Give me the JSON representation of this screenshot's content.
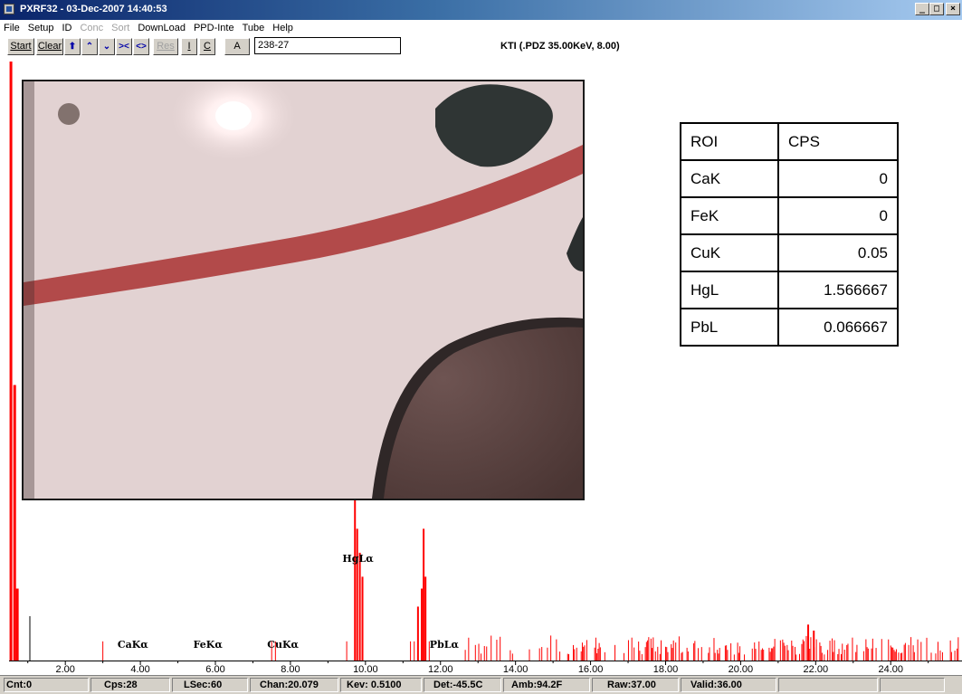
{
  "window": {
    "title": "PXRF32 - 03-Dec-2007 14:40:53",
    "minimize": "_",
    "maximize": "□",
    "close": "×"
  },
  "menu": [
    {
      "label": "File",
      "enabled": true
    },
    {
      "label": "Setup",
      "enabled": true
    },
    {
      "label": "ID",
      "enabled": true
    },
    {
      "label": "Conc",
      "enabled": false
    },
    {
      "label": "Sort",
      "enabled": false
    },
    {
      "label": "DownLoad",
      "enabled": true
    },
    {
      "label": "PPD-Inte",
      "enabled": true
    },
    {
      "label": "Tube",
      "enabled": true
    },
    {
      "label": "Help",
      "enabled": true
    }
  ],
  "toolbar": {
    "start": "Start",
    "clear": "Clear",
    "res": "Res",
    "i": "I",
    "c": "C",
    "a": "A",
    "sample_id": "238-27",
    "info": "KTI (.PDZ 35.00KeV, 8.00)"
  },
  "roi_table": {
    "headers": [
      "ROI",
      "CPS"
    ],
    "rows": [
      [
        "CaK",
        "0"
      ],
      [
        "FeK",
        "0"
      ],
      [
        "CuK",
        "0.05"
      ],
      [
        "HgL",
        "1.566667"
      ],
      [
        "PbL",
        "0.066667"
      ]
    ]
  },
  "chart_data": {
    "type": "bar",
    "xlabel": "",
    "ylabel": "",
    "xlim": [
      0.5,
      25.9
    ],
    "x_ticks": [
      "2.00",
      "4.00",
      "6.00",
      "8.00",
      "10.00",
      "12.00",
      "14.00",
      "16.00",
      "18.00",
      "20.00",
      "22.00",
      "24.00"
    ],
    "peak_labels": [
      {
        "label": "CaKα",
        "kev": 3.8
      },
      {
        "label": "FeKα",
        "kev": 5.8
      },
      {
        "label": "CuKα",
        "kev": 7.8
      },
      {
        "label": "HgLα",
        "kev": 9.8
      },
      {
        "label": "PbLα",
        "kev": 12.1
      }
    ],
    "major_peaks": [
      {
        "kev": 0.55,
        "counts": 100
      },
      {
        "kev": 0.65,
        "counts": 46
      },
      {
        "kev": 0.72,
        "counts": 12
      },
      {
        "kev": 9.72,
        "counts": 28
      },
      {
        "kev": 9.78,
        "counts": 22
      },
      {
        "kev": 9.85,
        "counts": 18
      },
      {
        "kev": 9.92,
        "counts": 14
      },
      {
        "kev": 11.4,
        "counts": 9
      },
      {
        "kev": 11.5,
        "counts": 12
      },
      {
        "kev": 11.55,
        "counts": 22
      },
      {
        "kev": 11.6,
        "counts": 14
      },
      {
        "kev": 21.8,
        "counts": 6
      },
      {
        "kev": 21.95,
        "counts": 5
      }
    ],
    "series_color": "#ff0000"
  },
  "statusbar": {
    "cnt": "Cnt:0",
    "cps": "Cps:28",
    "lsec": "LSec:60",
    "chan": "Chan:20.079",
    "kev": "Kev: 0.5100",
    "det": "Det:-45.5C",
    "amb": "Amb:94.2F",
    "raw": "Raw:37.00",
    "valid": "Valid:36.00"
  }
}
